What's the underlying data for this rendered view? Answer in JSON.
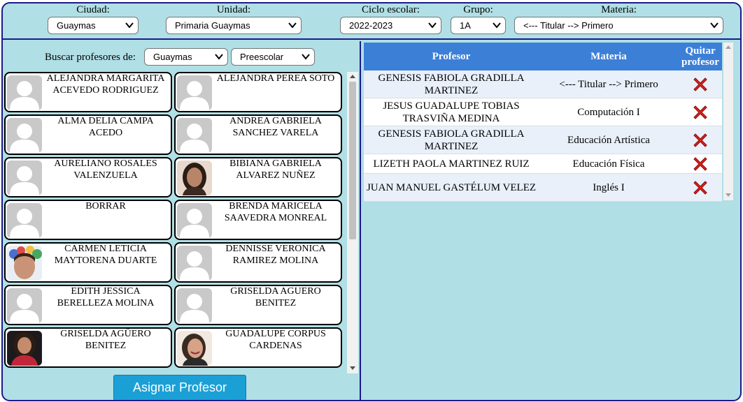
{
  "filters": {
    "ciudad": {
      "label": "Ciudad:",
      "value": "Guaymas"
    },
    "unidad": {
      "label": "Unidad:",
      "value": "Primaria Guaymas"
    },
    "ciclo": {
      "label": "Ciclo escolar:",
      "value": "2022-2023"
    },
    "grupo": {
      "label": "Grupo:",
      "value": "1A"
    },
    "materia": {
      "label": "Materia:",
      "value": "<--- Titular --> Primero"
    }
  },
  "search": {
    "label": "Buscar profesores de:",
    "city": "Guaymas",
    "level": "Preescolar"
  },
  "teachers": [
    {
      "name": "ALEJANDRA MARGARITA ACEVEDO RODRIGUEZ",
      "photo": "placeholder"
    },
    {
      "name": "ALEJANDRA PEREA SOTO",
      "photo": "placeholder"
    },
    {
      "name": "ALMA DELIA CAMPA ACEDO",
      "photo": "placeholder"
    },
    {
      "name": "ANDREA GABRIELA SANCHEZ VARELA",
      "photo": "placeholder"
    },
    {
      "name": "AURELIANO ROSALES VALENZUELA",
      "photo": "placeholder"
    },
    {
      "name": "BIBIANA GABRIELA ALVAREZ NUÑEZ",
      "photo": "photo-woman-dark-hair"
    },
    {
      "name": "BORRAR",
      "photo": "placeholder"
    },
    {
      "name": "BRENDA MARICELA SAAVEDRA MONREAL",
      "photo": "placeholder"
    },
    {
      "name": "CARMEN LETICIA MAYTORENA DUARTE",
      "photo": "photo-woman-floral"
    },
    {
      "name": "DENNISSE VERONICA RAMIREZ MOLINA",
      "photo": "placeholder"
    },
    {
      "name": "EDITH JESSICA BERELLEZA MOLINA",
      "photo": "placeholder"
    },
    {
      "name": "GRISELDA AGUERO BENITEZ",
      "photo": "placeholder"
    },
    {
      "name": "GRISELDA AGÜERO BENITEZ",
      "photo": "photo-woman-red-top"
    },
    {
      "name": "GUADALUPE CORPUS CARDENAS",
      "photo": "photo-woman-smiling"
    }
  ],
  "assign_button": "Asignar Profesor",
  "table": {
    "headers": {
      "profesor": "Profesor",
      "materia": "Materia",
      "quitar": "Quitar profesor"
    },
    "rows": [
      {
        "profesor": "GENESIS FABIOLA GRADILLA MARTINEZ",
        "materia": "<--- Titular --> Primero"
      },
      {
        "profesor": "JESUS GUADALUPE TOBIAS TRASVIÑA MEDINA",
        "materia": "Computación I"
      },
      {
        "profesor": "GENESIS FABIOLA GRADILLA MARTINEZ",
        "materia": "Educación Artística"
      },
      {
        "profesor": "LIZETH PAOLA MARTINEZ RUIZ",
        "materia": "Educación Física"
      },
      {
        "profesor": "JUAN MANUEL GASTÉLUM VELEZ",
        "materia": "Inglés I"
      }
    ]
  },
  "icons": {
    "remove": "remove-x-icon",
    "placeholder": "user-placeholder-icon"
  },
  "colors": {
    "background": "#b0dfe5",
    "border": "#1a1a8c",
    "header": "#3c7fd7",
    "button": "#1ba0d6",
    "remove": "#e0211d"
  }
}
